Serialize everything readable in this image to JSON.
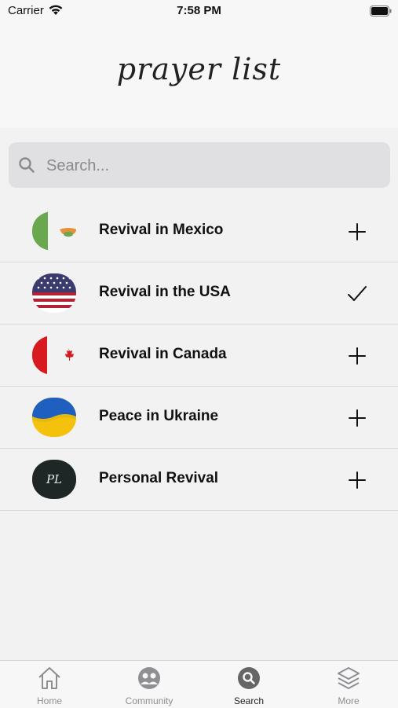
{
  "status_bar": {
    "carrier": "Carrier",
    "time": "7:58 PM"
  },
  "header": {
    "title": "prayer list"
  },
  "search": {
    "placeholder": "Search...",
    "value": ""
  },
  "list": {
    "items": [
      {
        "label": "Revival in Mexico",
        "flag": "mexico-flag-icon",
        "action": "plus-icon",
        "selected": false
      },
      {
        "label": "Revival in the USA",
        "flag": "usa-flag-icon",
        "action": "checkmark-icon",
        "selected": true
      },
      {
        "label": "Revival in Canada",
        "flag": "canada-flag-icon",
        "action": "plus-icon",
        "selected": false
      },
      {
        "label": "Peace in Ukraine",
        "flag": "ukraine-flag-icon",
        "action": "plus-icon",
        "selected": false
      },
      {
        "label": "Personal Revival",
        "flag": "personal-monogram-icon",
        "action": "plus-icon",
        "selected": false,
        "monogram": "PL"
      }
    ]
  },
  "tab_bar": {
    "tabs": [
      {
        "label": "Home",
        "icon": "home-icon",
        "active": false
      },
      {
        "label": "Community",
        "icon": "community-icon",
        "active": false
      },
      {
        "label": "Search",
        "icon": "search-icon",
        "active": true
      },
      {
        "label": "More",
        "icon": "layers-icon",
        "active": false
      }
    ]
  },
  "colors": {
    "background": "#f2f2f2",
    "search_field": "#e0e0e3",
    "mexico_green": "#6aa84f",
    "canada_red": "#d71920",
    "usa_blue": "#3c3b6e",
    "usa_red": "#b22234",
    "ukraine_blue": "#1f5fbf",
    "ukraine_yellow": "#f4c20d",
    "personal_dark": "#1f2626"
  }
}
